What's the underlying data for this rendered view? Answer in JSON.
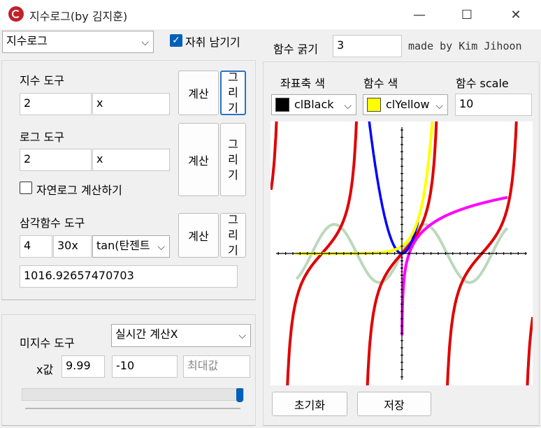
{
  "window": {
    "title": "지수로그(by 김지훈)",
    "minimize": "—",
    "maximize": "☐",
    "close": "✕"
  },
  "top": {
    "mode_select": "지수로그",
    "trace_checkbox": "자취 남기기",
    "trace_checked": true,
    "thickness_label": "함수 굵기",
    "thickness_value": "3",
    "credit": "made by Kim Jihoon"
  },
  "exp_tool": {
    "label": "지수 도구",
    "base": "2",
    "exponent": "x",
    "calc": "계산",
    "draw": [
      "그",
      "리",
      "기"
    ]
  },
  "log_tool": {
    "label": "로그 도구",
    "base": "2",
    "arg": "x",
    "calc": "계산",
    "draw": [
      "그",
      "리",
      "기"
    ],
    "natural_checkbox": "자연로그 계산하기"
  },
  "trig_tool": {
    "label": "삼각함수 도구",
    "coef": "4",
    "arg": "30x",
    "func": "tan(탄젠트",
    "calc": "계산",
    "draw": [
      "그",
      "리",
      "기"
    ],
    "result": "1016.92657470703"
  },
  "calculus_tool": {
    "label": "미지수 도구",
    "mode": "실시간 계산X",
    "x_label": "x값",
    "x_value": "9.99",
    "min_value": "-10",
    "max_placeholder": "최대값",
    "slider_fraction": 1.0
  },
  "graph_settings": {
    "axis_color_label": "좌표축 색",
    "axis_color": "clBlack",
    "axis_hex": "#000000",
    "func_color_label": "함수 색",
    "func_color": "clYellow",
    "func_hex": "#ffff00",
    "scale_label": "함수 scale",
    "scale_value": "10"
  },
  "bottom_buttons": {
    "reset": "초기화",
    "save": "저장"
  },
  "plot_colors": {
    "tan": "#e00000",
    "quadratic": "#0000ff",
    "exp": "#ffff00",
    "log": "#ff00ff",
    "sin": "#bcd8bc"
  }
}
